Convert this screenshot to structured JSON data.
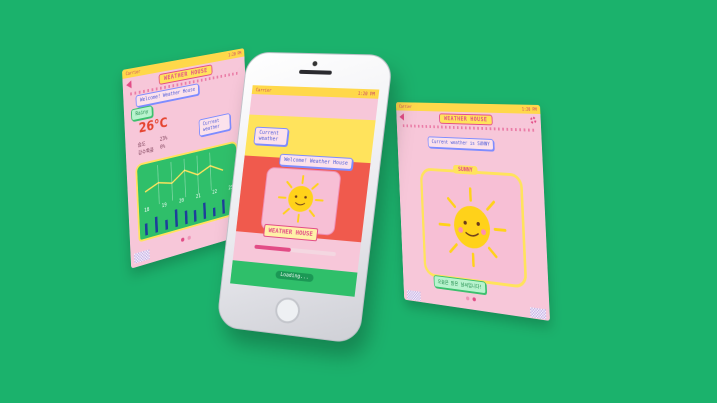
{
  "app": {
    "title": "WEATHER HOUSE",
    "carrier": "Carrier",
    "time": "1:20 PM"
  },
  "left_screen": {
    "welcome": "Welcome! Weather House",
    "tag": "Rainy",
    "current_weather_button": "Current weather",
    "temperature": "26°C",
    "humidity_label": "습도",
    "humidity_value": "23%",
    "rain_label": "강수확률",
    "rain_value": "0%",
    "chart_axis": [
      "18",
      "19",
      "20",
      "21",
      "22",
      "23"
    ]
  },
  "phone_screen": {
    "current_weather_button": "Current weather",
    "welcome": "Welcome! Weather House",
    "sign": "WEATHER HOUSE",
    "loading_label": "Loading...",
    "loading_progress": 0.45
  },
  "right_screen": {
    "current_weather_line": "Current weather is SUNNY",
    "condition": "SUNNY",
    "message": "오늘은 맑은 날씨입니다!"
  },
  "colors": {
    "background": "#1bb26c",
    "pink": "#f7c7d9",
    "yellow": "#ffe35c",
    "accent": "#e24c86",
    "green": "#2fbf6a"
  }
}
